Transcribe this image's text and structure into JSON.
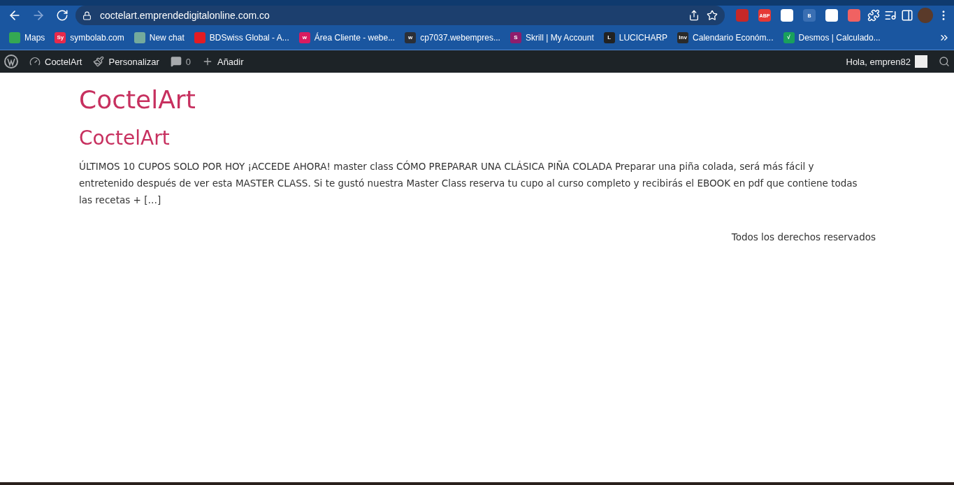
{
  "browser": {
    "url": "coctelart.emprendedigitalonline.com.co",
    "extensions": [
      {
        "color": "#c62828"
      },
      {
        "color": "#e53935",
        "icon_text": "ABP"
      },
      {
        "color": "#ffffff"
      },
      {
        "color": "#3a6fb3",
        "icon_text": "B"
      },
      {
        "color": "#ffffff"
      },
      {
        "color": "#f06262"
      }
    ]
  },
  "bookmarks": [
    {
      "label": "Maps",
      "color": "#34a853"
    },
    {
      "label": "symbolab.com",
      "color": "#e8294b",
      "icon_text": "Sy"
    },
    {
      "label": "New chat",
      "color": "#74aa9c"
    },
    {
      "label": "BDSwiss Global - A...",
      "color": "#e31b23"
    },
    {
      "label": "Área Cliente - webe...",
      "color": "#d81b60",
      "icon_text": "w"
    },
    {
      "label": "cp7037.webempres...",
      "color": "#2b2f36",
      "icon_text": "w"
    },
    {
      "label": "Skrill | My Account",
      "color": "#8f1d6c",
      "icon_text": "S"
    },
    {
      "label": "LUCICHARP",
      "color": "#222222",
      "icon_text": "L"
    },
    {
      "label": "Calendario Económ...",
      "color": "#2a2a2a",
      "icon_text": "Inv"
    },
    {
      "label": "Desmos | Calculado...",
      "color": "#19a05c",
      "icon_text": "√"
    }
  ],
  "admin_bar": {
    "site": "CoctelArt",
    "customize": "Personalizar",
    "comments": "0",
    "new": "Añadir",
    "greeting": "Hola, empren82"
  },
  "site_title": "CoctelArt",
  "post": {
    "title": "CoctelArt",
    "excerpt": "ÚLTIMOS 10 CUPOS SOLO POR HOY ¡ACCEDE AHORA! master class CÓMO PREPARAR UNA CLÁSICA PIÑA COLADA Preparar una piña colada, será más fácil y entretenido después de ver esta MASTER CLASS. Si te gustó nuestra Master Class reserva tu cupo al curso completo y recibirás el EBOOK en pdf que contiene todas las recetas + […]"
  },
  "footer": "Todos los derechos reservados"
}
